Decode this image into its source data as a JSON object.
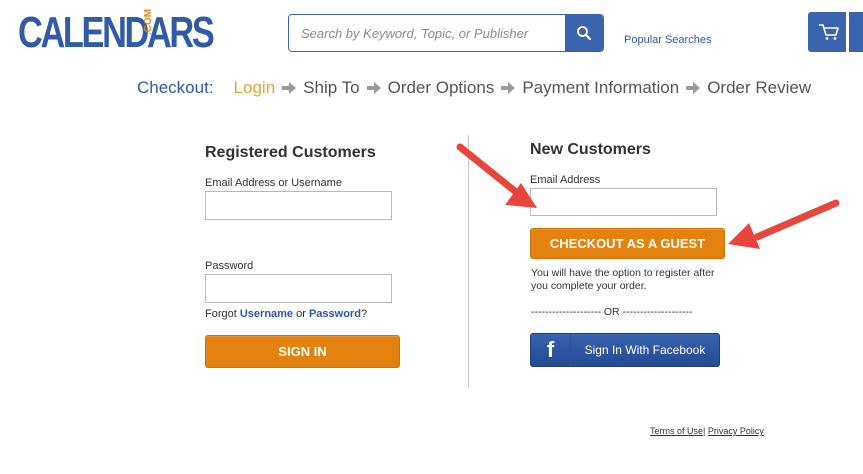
{
  "header": {
    "logo_text": "CALENDARS",
    "logo_suffix": ".COM",
    "search_placeholder": "Search by Keyword, Topic, or Publisher",
    "search_icon": "search-icon",
    "popular_searches": "Popular Searches",
    "cart_icon": "cart-icon"
  },
  "checkout_steps": {
    "label": "Checkout:",
    "steps": [
      "Login",
      "Ship To",
      "Order Options",
      "Payment Information",
      "Order Review"
    ],
    "active_step": "Login"
  },
  "registered": {
    "title": "Registered Customers",
    "email_label": "Email Address or Username",
    "email_value": "",
    "password_label": "Password",
    "password_value": "",
    "forgot_prefix": "Forgot",
    "forgot_username": "Username",
    "forgot_or": "or",
    "forgot_password": "Password",
    "forgot_suffix": "?",
    "sign_in": "SIGN IN"
  },
  "new_customers": {
    "title": "New Customers",
    "email_label": "Email Address",
    "email_value": "",
    "guest_button": "CHECKOUT AS A GUEST",
    "note": "You will have the option to register after you complete your order.",
    "or_separator": "-------------------- OR --------------------",
    "facebook_icon": "facebook-icon",
    "facebook_button": "Sign In With Facebook"
  },
  "footer": {
    "terms": "Terms of Use",
    "separator": "|",
    "privacy": "Privacy Policy"
  },
  "colors": {
    "brand_blue": "#2f5ba8",
    "accent_orange": "#e4820f",
    "annotation_red": "#e8453c",
    "active_step": "#e8a03a"
  }
}
